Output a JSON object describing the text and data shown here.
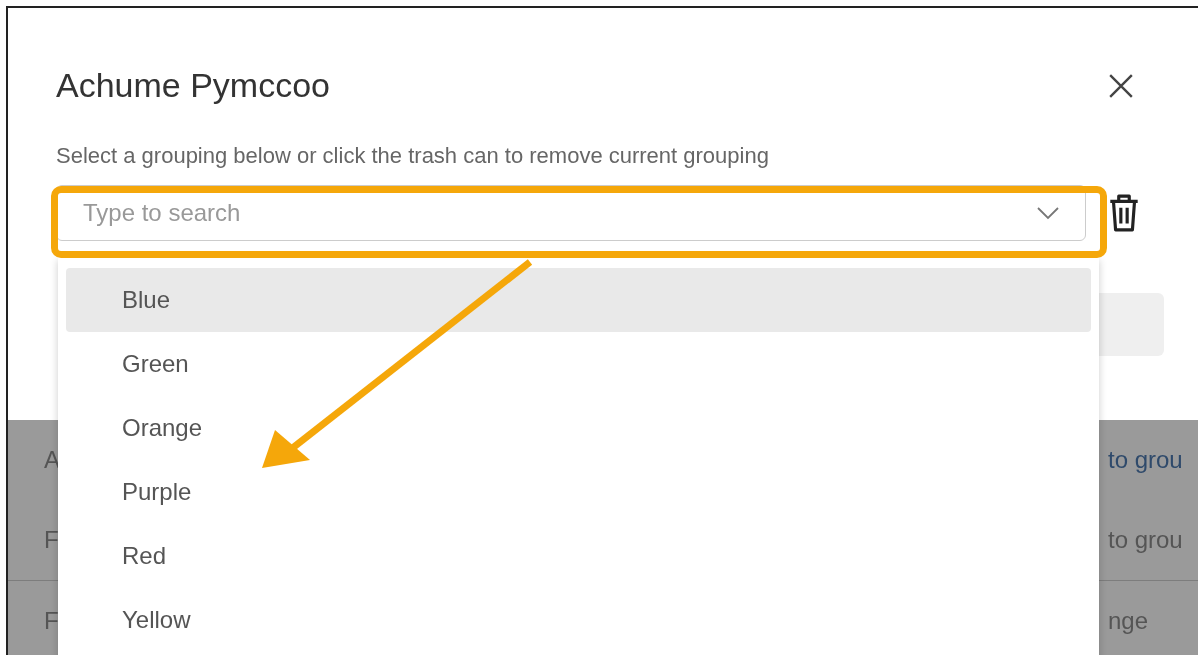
{
  "dialog": {
    "title": "Achume Pymccoo",
    "instruction": "Select a grouping below or click the trash can to remove current grouping",
    "search": {
      "placeholder": "Type to search"
    }
  },
  "dropdown": {
    "options": [
      {
        "label": "Blue",
        "selected": true
      },
      {
        "label": "Green",
        "selected": false
      },
      {
        "label": "Orange",
        "selected": false
      },
      {
        "label": "Purple",
        "selected": false
      },
      {
        "label": "Red",
        "selected": false
      },
      {
        "label": "Yellow",
        "selected": false
      }
    ]
  },
  "background_rows": [
    {
      "column_1": "A",
      "column_2": "to grou",
      "link": true
    },
    {
      "column_1": "F",
      "column_2": "to grou",
      "link": false
    },
    {
      "column_1": "F",
      "column_2": "nge",
      "link": false
    }
  ]
}
